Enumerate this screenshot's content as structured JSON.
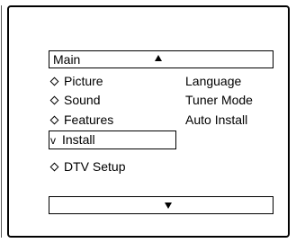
{
  "menu": {
    "title": "Main",
    "items": [
      {
        "label": "Picture",
        "marker": "diamond"
      },
      {
        "label": "Sound",
        "marker": "diamond"
      },
      {
        "label": "Features",
        "marker": "diamond"
      },
      {
        "label": "Install",
        "marker": "check",
        "check_glyph": "v"
      },
      {
        "label": "DTV Setup",
        "marker": "diamond"
      }
    ],
    "submenu": [
      "Language",
      "Tuner Mode",
      "Auto Install"
    ]
  },
  "icons": {
    "scroll_up": "up-triangle-icon",
    "scroll_down": "down-triangle-icon",
    "item_bullet": "diamond-bullet-icon"
  }
}
